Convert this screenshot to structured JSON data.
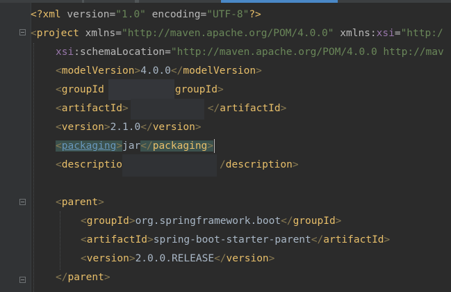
{
  "editor": {
    "xml_decl": {
      "open": "<?",
      "name": "xml",
      "version_attr": "version",
      "version_val": "\"1.0\"",
      "encoding_attr": "encoding",
      "encoding_val": "\"UTF-8\"",
      "close": "?>"
    },
    "project": {
      "tag": "project",
      "xmlns_attr": "xmlns",
      "xmlns_val": "\"http://maven.apache.org/POM/4.0.0\"",
      "xmlns_xsi_prefix": "xmlns",
      "xmlns_xsi_name": "xsi",
      "xmlns_xsi_val": "\"http:/",
      "schema_prefix": "xsi",
      "schema_name": "schemaLocation",
      "schema_val": "\"http://maven.apache.org/POM/4.0.0 http://mav"
    },
    "lines": {
      "modelVersion": {
        "tag": "modelVersion",
        "value": "4.0.0"
      },
      "groupId": {
        "open_tag": "groupId",
        "close_tag": "groupId"
      },
      "artifactId": {
        "open_tag": "artifactId",
        "close_tag": "artifactId"
      },
      "version": {
        "tag": "version",
        "value": "2.1.0"
      },
      "packaging": {
        "tag": "packaging",
        "value": "jar"
      },
      "description": {
        "open_tag": "descriptio",
        "close_tag": "description"
      }
    },
    "parent": {
      "tag": "parent",
      "groupId": {
        "tag": "groupId",
        "value": "org.springframework.boot"
      },
      "artifactId": {
        "tag": "artifactId",
        "value": "spring-boot-starter-parent"
      },
      "version": {
        "tag": "version",
        "value": "2.0.0.RELEASE"
      }
    }
  },
  "colors": {
    "background": "#2b2b2b",
    "gutter": "#313335",
    "tag": "#e8bf6a",
    "attr_value": "#6a8759",
    "namespace": "#9876aa",
    "text": "#a9b7c6",
    "active_tab": "#4a88c7"
  },
  "icons": [
    "fold-collapse-icon"
  ]
}
